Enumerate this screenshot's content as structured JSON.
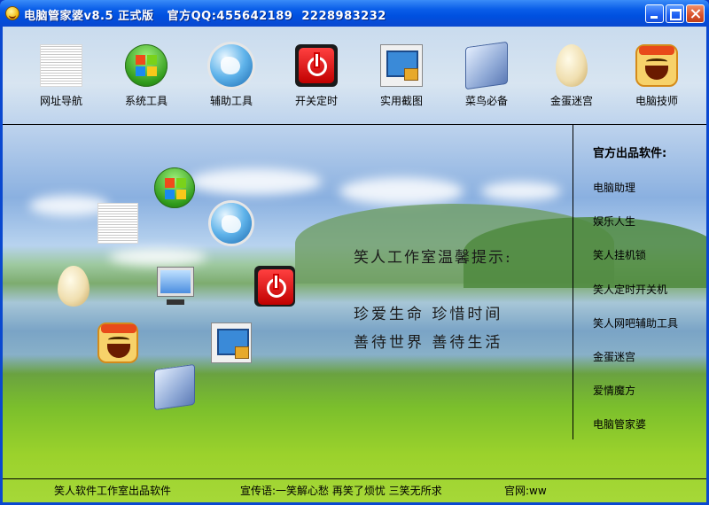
{
  "window": {
    "title": "电脑管家婆v8.5 正式版   官方QQ:455642189  2228983232"
  },
  "toolbar": {
    "items": [
      {
        "label": "网址导航",
        "icon": "document-icon"
      },
      {
        "label": "系统工具",
        "icon": "windows-logo-icon"
      },
      {
        "label": "辅助工具",
        "icon": "globe-icon"
      },
      {
        "label": "开关定时",
        "icon": "power-icon"
      },
      {
        "label": "实用截图",
        "icon": "screenshot-icon"
      },
      {
        "label": "菜鸟必备",
        "icon": "folder-icon"
      },
      {
        "label": "金蛋迷宫",
        "icon": "egg-icon"
      },
      {
        "label": "电脑技师",
        "icon": "laughing-face-icon"
      }
    ]
  },
  "tips": {
    "title": "笑人工作室温馨提示:",
    "line1": "珍爱生命   珍惜时间",
    "line2": "善待世界   善待生活"
  },
  "sidebar": {
    "title": "官方出品软件:",
    "items": [
      "电脑助理",
      "娱乐人生",
      "笑人挂机锁",
      "笑人定时开关机",
      "笑人网吧辅助工具",
      "金蛋迷宫",
      "爱情魔方",
      "电脑管家婆"
    ]
  },
  "footer": {
    "studio": "笑人软件工作室出品软件",
    "slogan": "宣传语:一笑解心愁   再笑了烦忧   三笑无所求",
    "website_label": "官网:",
    "website_value": "ww"
  },
  "colors": {
    "titlebar": "#0a5ee8",
    "sidebar_border": "#000000"
  }
}
